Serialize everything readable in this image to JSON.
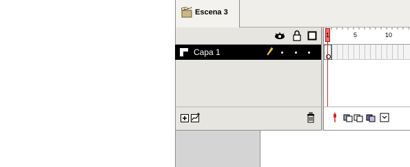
{
  "scene": {
    "label": "Escena 3"
  },
  "layers": [
    {
      "name": "Capa 1"
    }
  ],
  "ruler": {
    "one": "1",
    "five": "5",
    "ten": "10"
  },
  "icons": {
    "scene": "scene-clapper-icon",
    "eye": "eye-icon",
    "lock": "lock-icon",
    "outline": "outline-square-icon",
    "pencil": "pencil-icon",
    "add_layer": "add-layer-icon",
    "add_guide": "add-motion-guide-icon",
    "delete": "trash-icon"
  },
  "colors": {
    "playhead": "#e02020",
    "selected_layer": "#000000"
  }
}
